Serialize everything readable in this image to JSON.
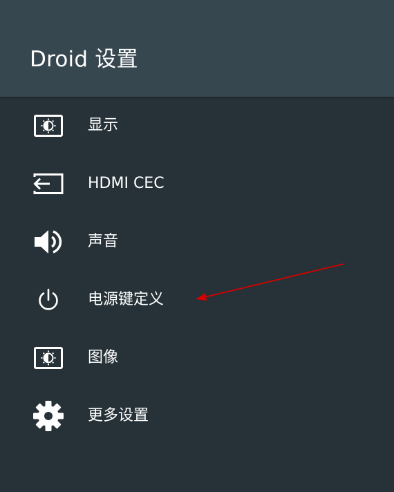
{
  "header": {
    "title": "Droid 设置"
  },
  "menu": {
    "items": [
      {
        "label": "显示",
        "icon": "display-brightness-icon"
      },
      {
        "label": "HDMI CEC",
        "icon": "input-icon"
      },
      {
        "label": "声音",
        "icon": "speaker-icon"
      },
      {
        "label": "电源键定义",
        "icon": "power-icon"
      },
      {
        "label": "图像",
        "icon": "picture-brightness-icon"
      },
      {
        "label": "更多设置",
        "icon": "gear-icon"
      }
    ]
  },
  "colors": {
    "background": "#263238",
    "header": "#37474f",
    "text": "#ffffff",
    "annotation_arrow": "#d50000"
  }
}
